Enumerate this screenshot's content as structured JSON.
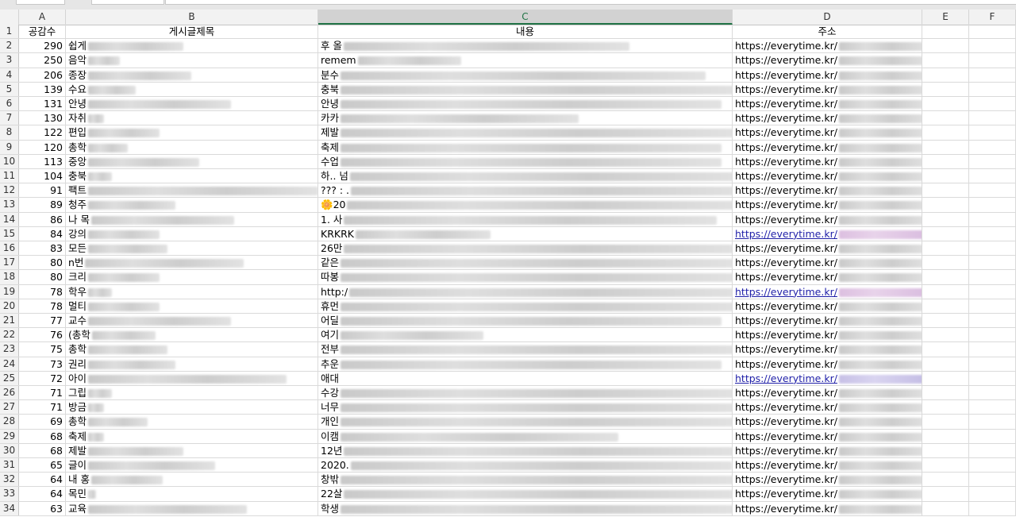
{
  "columns": [
    "A",
    "B",
    "C",
    "D",
    "E",
    "F"
  ],
  "selected_column": "C",
  "header_row": {
    "row": "1",
    "a": "공감수",
    "b": "게시글제목",
    "c": "내용",
    "d": "주소"
  },
  "url_prefix": "https://everytime.kr/",
  "rows": [
    {
      "row": "2",
      "a": "290",
      "b": "쉽게",
      "c": "후 올"
    },
    {
      "row": "3",
      "a": "250",
      "b": "음악",
      "c": "remem"
    },
    {
      "row": "4",
      "a": "206",
      "b": "종장",
      "c": "분수"
    },
    {
      "row": "5",
      "a": "139",
      "b": "수요",
      "c": "충북"
    },
    {
      "row": "6",
      "a": "131",
      "b": "안녕",
      "c": "안녕"
    },
    {
      "row": "7",
      "a": "130",
      "b": "자취",
      "c": "카카"
    },
    {
      "row": "8",
      "a": "122",
      "b": "편입",
      "c": "제발"
    },
    {
      "row": "9",
      "a": "120",
      "b": "총학",
      "c": "축제"
    },
    {
      "row": "10",
      "a": "113",
      "b": "중앙",
      "c": "수업"
    },
    {
      "row": "11",
      "a": "104",
      "b": "충북",
      "c": "하.. 넘"
    },
    {
      "row": "12",
      "a": "91",
      "b": "팩트",
      "c": "??? : ."
    },
    {
      "row": "13",
      "a": "89",
      "b": "청주",
      "c": "🌼20"
    },
    {
      "row": "14",
      "a": "86",
      "b": "나 목",
      "c": "1. 사"
    },
    {
      "row": "15",
      "a": "84",
      "b": "강의",
      "c": "KRKRK"
    },
    {
      "row": "16",
      "a": "83",
      "b": "모든",
      "c": "26만"
    },
    {
      "row": "17",
      "a": "80",
      "b": "n번",
      "c": "같은"
    },
    {
      "row": "18",
      "a": "80",
      "b": "크리",
      "c": "따봉"
    },
    {
      "row": "19",
      "a": "78",
      "b": "학우",
      "c": "http:/"
    },
    {
      "row": "20",
      "a": "78",
      "b": "멀티",
      "c": "휴먼"
    },
    {
      "row": "21",
      "a": "77",
      "b": "교수",
      "c": "어딜"
    },
    {
      "row": "22",
      "a": "76",
      "b": "(총학",
      "c": "여기"
    },
    {
      "row": "23",
      "a": "75",
      "b": "총학",
      "c": "전부"
    },
    {
      "row": "24",
      "a": "73",
      "b": "권리",
      "c": "추운"
    },
    {
      "row": "25",
      "a": "72",
      "b": "아이",
      "c": "애대"
    },
    {
      "row": "26",
      "a": "71",
      "b": "그립",
      "c": "수강"
    },
    {
      "row": "27",
      "a": "71",
      "b": "방금",
      "c": "너무"
    },
    {
      "row": "28",
      "a": "69",
      "b": "총학",
      "c": "개인"
    },
    {
      "row": "29",
      "a": "68",
      "b": "축제",
      "c": "이캠"
    },
    {
      "row": "30",
      "a": "68",
      "b": "제발",
      "c": "12년"
    },
    {
      "row": "31",
      "a": "65",
      "b": "글이",
      "c": "2020."
    },
    {
      "row": "32",
      "a": "64",
      "b": "내 홍",
      "c": "창밖"
    },
    {
      "row": "33",
      "a": "64",
      "b": "목민",
      "c": "22살"
    },
    {
      "row": "34",
      "a": "63",
      "b": "교육",
      "c": "학생"
    }
  ]
}
